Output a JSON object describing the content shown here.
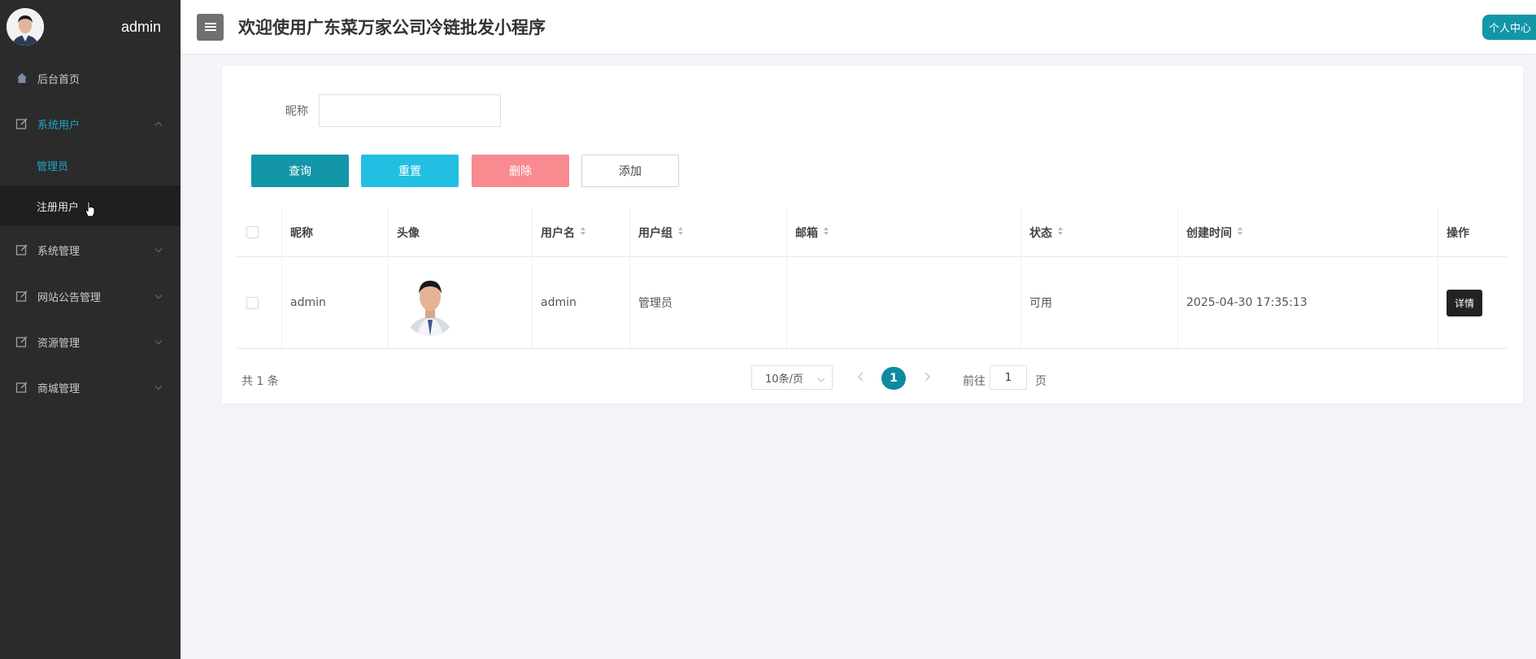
{
  "sidebar": {
    "username": "admin",
    "items": [
      {
        "label": "后台首页",
        "icon": "home-icon"
      },
      {
        "label": "系统用户",
        "icon": "edit-icon",
        "expanded": true
      },
      {
        "label": "系统管理",
        "icon": "edit-icon"
      },
      {
        "label": "网站公告管理",
        "icon": "edit-icon"
      },
      {
        "label": "资源管理",
        "icon": "edit-icon"
      },
      {
        "label": "商城管理",
        "icon": "edit-icon"
      }
    ],
    "subitems": [
      {
        "label": "管理员"
      },
      {
        "label": "注册用户"
      }
    ]
  },
  "header": {
    "title": "欢迎使用广东菜万家公司冷链批发小程序",
    "user_center": "个人中心"
  },
  "search": {
    "label": "昵称",
    "value": ""
  },
  "toolbar": {
    "query": "查询",
    "reset": "重置",
    "delete": "删除",
    "add": "添加"
  },
  "table": {
    "columns": [
      "昵称",
      "头像",
      "用户名",
      "用户组",
      "邮箱",
      "状态",
      "创建时间",
      "操作"
    ],
    "rows": [
      {
        "nickname": "admin",
        "username": "admin",
        "group": "管理员",
        "email": "",
        "status": "可用",
        "created": "2025-04-30 17:35:13",
        "action": "详情"
      }
    ]
  },
  "pagination": {
    "total": "共 1 条",
    "page_size": "10条/页",
    "current": "1",
    "goto_label": "前往",
    "goto_value": "1",
    "page_label": "页"
  },
  "colors": {
    "sidebar_bg": "#2b2b2b",
    "accent": "#1296a8",
    "reset": "#23bfe2",
    "delete": "#f78b90"
  }
}
